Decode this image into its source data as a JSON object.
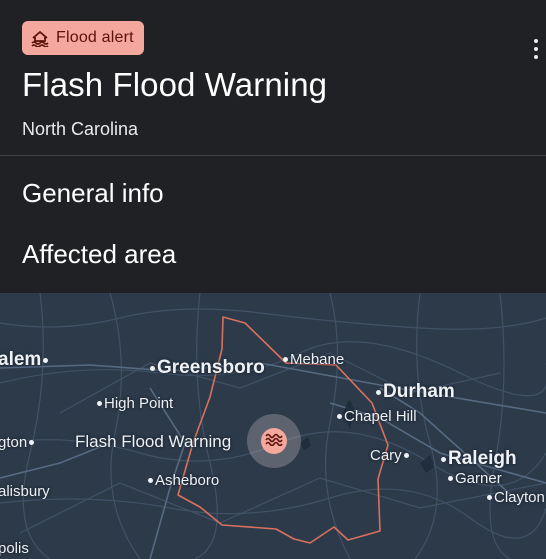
{
  "alert": {
    "chip_label": "Flood alert",
    "chip_icon": "flood-house-icon",
    "title": "Flash Flood Warning",
    "region": "North Carolina"
  },
  "sections": {
    "general": "General info",
    "affected": "Affected area"
  },
  "map": {
    "warning_label": "Flash Flood Warning",
    "pin_icon": "water-waves-icon",
    "colors": {
      "background": "#2c3a4a",
      "boundary": "#d9705f",
      "pin": "#f4a79d"
    },
    "places": {
      "salem": "alem",
      "greensboro": "Greensboro",
      "mebane": "Mebane",
      "durham": "Durham",
      "high_point": "High Point",
      "chapel_hill": "Chapel Hill",
      "lexington": "gton",
      "cary": "Cary",
      "raleigh": "Raleigh",
      "asheboro": "Asheboro",
      "garner": "Garner",
      "salisbury": "alisbury",
      "clayton": "Clayton",
      "kannapolis": "polis"
    }
  }
}
